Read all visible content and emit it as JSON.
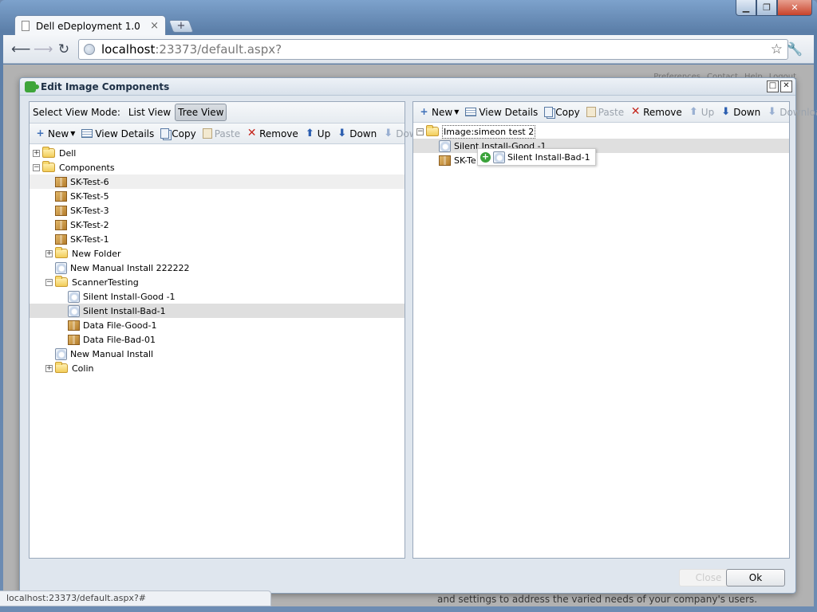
{
  "browser": {
    "tab_title": "Dell eDeployment 1.0",
    "tab_close": "×",
    "new_tab": "+",
    "url_host": "localhost",
    "url_rest": ":23373/default.aspx?",
    "status_url": "localhost:23373/default.aspx?#"
  },
  "background_page": {
    "links": [
      "Preferences",
      "Contact",
      "Help",
      "Logout"
    ],
    "footer_text": "and settings to address the varied needs of your company's users."
  },
  "dialog": {
    "title": "Edit Image Components",
    "restore_glyph": "□",
    "close_glyph": "✕",
    "close_button": "Close",
    "ok_button": "Ok"
  },
  "left_panel": {
    "view_mode_label": "Select View Mode:",
    "view_modes": [
      "List View",
      "Tree View"
    ],
    "active_view_mode": "Tree View",
    "toolbar": {
      "new": "New",
      "view_details": "View Details",
      "copy": "Copy",
      "paste": "Paste",
      "remove": "Remove",
      "up": "Up",
      "down": "Down",
      "download": "Download"
    },
    "tree": [
      {
        "label": "Dell",
        "icon": "folder-icon",
        "expander": "+"
      },
      {
        "label": "Components",
        "icon": "folder-open-icon",
        "expander": "−"
      },
      {
        "label": "SK-Test-6",
        "icon": "package-icon"
      },
      {
        "label": "SK-Test-5",
        "icon": "package-icon"
      },
      {
        "label": "SK-Test-3",
        "icon": "package-icon"
      },
      {
        "label": "SK-Test-2",
        "icon": "package-icon"
      },
      {
        "label": "SK-Test-1",
        "icon": "package-icon"
      },
      {
        "label": "New Folder",
        "icon": "folder-icon",
        "expander": "+"
      },
      {
        "label": "New Manual Install 222222",
        "icon": "installer-icon"
      },
      {
        "label": "ScannerTesting",
        "icon": "folder-open-icon",
        "expander": "−"
      },
      {
        "label": "Silent Install-Good -1",
        "icon": "installer-icon"
      },
      {
        "label": "Silent Install-Bad-1",
        "icon": "installer-icon"
      },
      {
        "label": "Data File-Good-1",
        "icon": "package-icon"
      },
      {
        "label": "Data File-Bad-01",
        "icon": "package-icon"
      },
      {
        "label": "New Manual Install",
        "icon": "installer-icon"
      },
      {
        "label": "Colin",
        "icon": "folder-icon",
        "expander": "+"
      }
    ]
  },
  "right_panel": {
    "toolbar": {
      "new": "New",
      "view_details": "View Details",
      "copy": "Copy",
      "paste": "Paste",
      "remove": "Remove",
      "up": "Up",
      "down": "Down",
      "download": "Download"
    },
    "tree": [
      {
        "label": "Image:simeon test 2",
        "icon": "folder-open-icon",
        "expander": "−"
      },
      {
        "label": "Silent Install-Good -1",
        "icon": "installer-icon"
      },
      {
        "label": "SK-Te",
        "icon": "package-icon"
      }
    ],
    "drag_proxy_label": "Silent Install-Bad-1"
  }
}
